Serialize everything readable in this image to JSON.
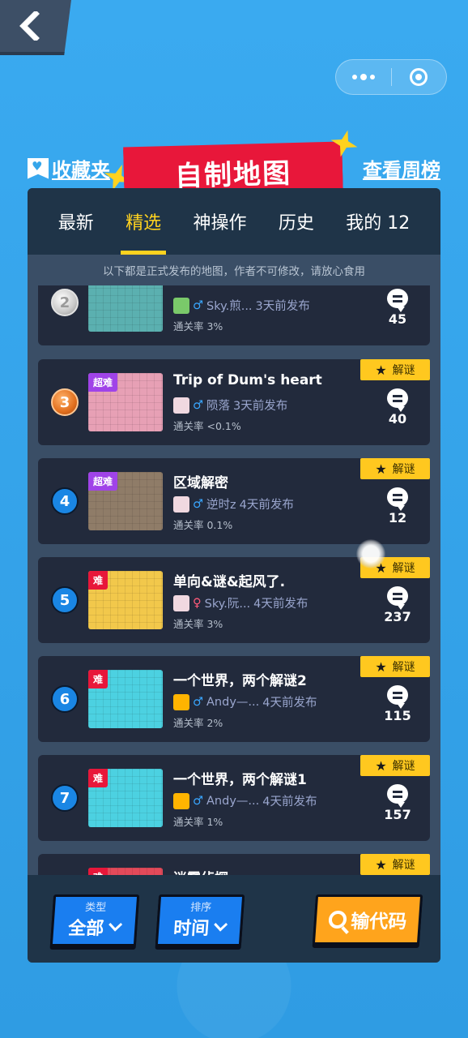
{
  "header": {
    "favorites_label": "收藏夹",
    "page_title": "自制地图",
    "weekly_label": "查看周榜"
  },
  "tabs": [
    {
      "label": "最新",
      "active": false
    },
    {
      "label": "精选",
      "active": true
    },
    {
      "label": "神操作",
      "active": false
    },
    {
      "label": "历史",
      "active": false
    },
    {
      "label": "我的 12",
      "active": false
    }
  ],
  "notice": "以下都是正式发布的地图，作者不可修改，请放心食用",
  "cards": [
    {
      "rank": "2",
      "title": "",
      "difficulty": "",
      "author": "Sky.煎...",
      "gender": "♂",
      "published": "3天前发布",
      "pass_rate": "通关率 3%",
      "comments": "45",
      "tag": ""
    },
    {
      "rank": "3",
      "title": "Trip of Dum's heart",
      "difficulty": "超难",
      "author": "陨落",
      "gender": "♂",
      "published": "3天前发布",
      "pass_rate": "通关率 <0.1%",
      "comments": "40",
      "tag": "解谜"
    },
    {
      "rank": "4",
      "title": "区域解密",
      "difficulty": "超难",
      "author": "逆时z",
      "gender": "♂",
      "published": "4天前发布",
      "pass_rate": "通关率 0.1%",
      "comments": "12",
      "tag": "解谜"
    },
    {
      "rank": "5",
      "title": "单向&谜&起风了.",
      "difficulty": "难",
      "author": "Sky.阮...",
      "gender": "♀",
      "published": "4天前发布",
      "pass_rate": "通关率 3%",
      "comments": "237",
      "tag": "解谜"
    },
    {
      "rank": "6",
      "title": "一个世界，两个解谜2",
      "difficulty": "难",
      "author": "Andy—...",
      "gender": "♂",
      "published": "4天前发布",
      "pass_rate": "通关率 2%",
      "comments": "115",
      "tag": "解谜"
    },
    {
      "rank": "7",
      "title": "一个世界，两个解谜1",
      "difficulty": "难",
      "author": "Andy—...",
      "gender": "♂",
      "published": "4天前发布",
      "pass_rate": "通关率 1%",
      "comments": "157",
      "tag": "解谜"
    },
    {
      "rank": "",
      "title": "迷雾侦探",
      "difficulty": "难",
      "author": "",
      "gender": "",
      "published": "",
      "pass_rate": "",
      "comments": "",
      "tag": "解谜"
    }
  ],
  "bottom": {
    "type_label": "类型",
    "type_value": "全部",
    "sort_label": "排序",
    "sort_value": "时间",
    "code_button": "输代码"
  },
  "colors": {
    "background": "#35a6ea",
    "accent_yellow": "#ffd21f",
    "title_red": "#e8173a",
    "button_blue": "#1a7ef0",
    "button_orange": "#ffa41c"
  }
}
